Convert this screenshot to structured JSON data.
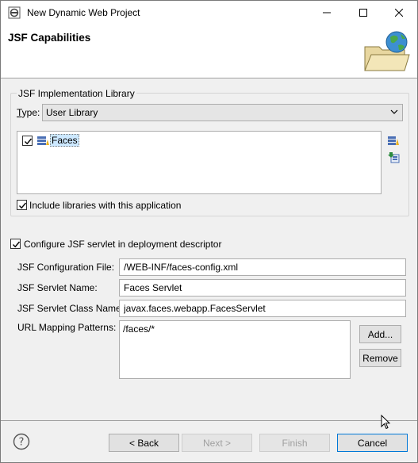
{
  "window": {
    "title": "New Dynamic Web Project",
    "minimize_icon": "minimize-icon",
    "maximize_icon": "maximize-icon",
    "close_icon": "close-icon"
  },
  "banner": {
    "title": "JSF Capabilities",
    "graphic_icon": "globe-folder-icon"
  },
  "library_group": {
    "legend": "JSF Implementation Library",
    "type_label": "Type:",
    "type_value": "User Library",
    "libraries": [
      {
        "label": "Faces",
        "checked": true
      }
    ],
    "include_label": "Include libraries with this application",
    "include_checked": true
  },
  "servlet": {
    "configure_label": "Configure JSF servlet in deployment descriptor",
    "configure_checked": true,
    "config_file_label": "JSF Configuration File:",
    "config_file_value": "/WEB-INF/faces-config.xml",
    "servlet_name_label": "JSF Servlet Name:",
    "servlet_name_value": "Faces Servlet",
    "servlet_class_label": "JSF Servlet Class Name:",
    "servlet_class_value": "javax.faces.webapp.FacesServlet",
    "url_mapping_label": "URL Mapping Patterns:",
    "url_mapping_value": "/faces/*",
    "add_label": "Add...",
    "remove_label": "Remove"
  },
  "footer": {
    "back_label": "< Back",
    "next_label": "Next >",
    "finish_label": "Finish",
    "cancel_label": "Cancel"
  }
}
